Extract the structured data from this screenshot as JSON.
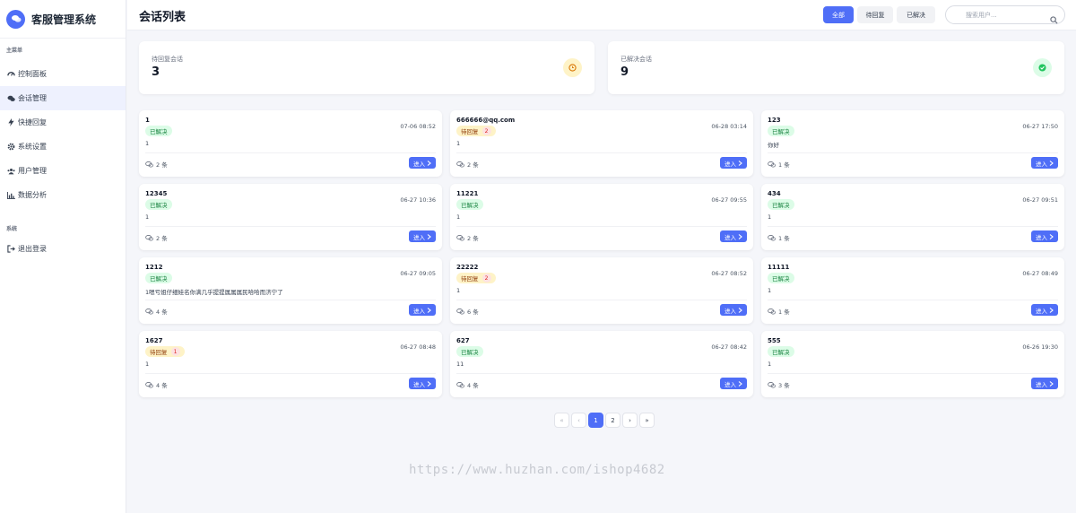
{
  "app": {
    "title": "客服管理系统",
    "brand_color": "#4f6ef7"
  },
  "sidebar": {
    "main_section": "主菜单",
    "items": [
      {
        "label": "控制面板",
        "icon": "dashboard-icon",
        "active": false
      },
      {
        "label": "会话管理",
        "icon": "chat-icon",
        "active": true
      },
      {
        "label": "快捷回复",
        "icon": "bolt-icon",
        "active": false
      },
      {
        "label": "系统设置",
        "icon": "gear-icon",
        "active": false
      },
      {
        "label": "用户管理",
        "icon": "users-icon",
        "active": false
      },
      {
        "label": "数据分析",
        "icon": "bar-chart-icon",
        "active": false
      }
    ],
    "system_section": "系统",
    "logout_label": "退出登录"
  },
  "header": {
    "title": "会话列表",
    "filters": [
      {
        "label": "全部",
        "active": true
      },
      {
        "label": "待回复",
        "active": false
      },
      {
        "label": "已解决",
        "active": false
      }
    ],
    "search_placeholder": "搜索用户..."
  },
  "stats": {
    "pending": {
      "label": "待回复会话",
      "value": "3",
      "color": "#f59e0b"
    },
    "resolved": {
      "label": "已解决会话",
      "value": "9",
      "color": "#22c55e"
    }
  },
  "sessions": [
    {
      "user": "1",
      "status": "已解决",
      "status_type": "resolved",
      "unread": "",
      "time": "07-06 08:52",
      "message": "1",
      "count": "2 条",
      "action": "进入"
    },
    {
      "user": "666666@qq.com",
      "status": "待回复",
      "status_type": "pending",
      "unread": "2",
      "time": "06-28 03:14",
      "message": "1",
      "count": "2 条",
      "action": "进入"
    },
    {
      "user": "123",
      "status": "已解决",
      "status_type": "resolved",
      "unread": "",
      "time": "06-27 17:50",
      "message": "你好",
      "count": "1 条",
      "action": "进入"
    },
    {
      "user": "12345",
      "status": "已解决",
      "status_type": "resolved",
      "unread": "",
      "time": "06-27 10:36",
      "message": "1",
      "count": "2 条",
      "action": "进入"
    },
    {
      "user": "11221",
      "status": "已解决",
      "status_type": "resolved",
      "unread": "",
      "time": "06-27 09:55",
      "message": "1",
      "count": "2 条",
      "action": "进入"
    },
    {
      "user": "434",
      "status": "已解决",
      "status_type": "resolved",
      "unread": "",
      "time": "06-27 09:51",
      "message": "1",
      "count": "1 条",
      "action": "进入"
    },
    {
      "user": "1212",
      "status": "已解决",
      "status_type": "resolved",
      "unread": "",
      "time": "06-27 09:05",
      "message": "1嗯亏姐仔细娃名你满几乎提提属属属民哈哈而济宁了",
      "count": "4 条",
      "action": "进入"
    },
    {
      "user": "22222",
      "status": "待回复",
      "status_type": "pending",
      "unread": "2",
      "time": "06-27 08:52",
      "message": "1",
      "count": "6 条",
      "action": "进入"
    },
    {
      "user": "11111",
      "status": "已解决",
      "status_type": "resolved",
      "unread": "",
      "time": "06-27 08:49",
      "message": "1",
      "count": "1 条",
      "action": "进入"
    },
    {
      "user": "1627",
      "status": "待回复",
      "status_type": "pending",
      "unread": "1",
      "time": "06-27 08:48",
      "message": "1",
      "count": "4 条",
      "action": "进入"
    },
    {
      "user": "627",
      "status": "已解决",
      "status_type": "resolved",
      "unread": "",
      "time": "06-27 08:42",
      "message": "11",
      "count": "4 条",
      "action": "进入"
    },
    {
      "user": "555",
      "status": "已解决",
      "status_type": "resolved",
      "unread": "",
      "time": "06-26 19:30",
      "message": "1",
      "count": "3 条",
      "action": "进入"
    }
  ],
  "pagination": {
    "first": "«",
    "prev": "‹",
    "pages": [
      "1",
      "2"
    ],
    "current": "1",
    "next": "›",
    "last": "»"
  },
  "watermark": "https://www.huzhan.com/ishop4682"
}
